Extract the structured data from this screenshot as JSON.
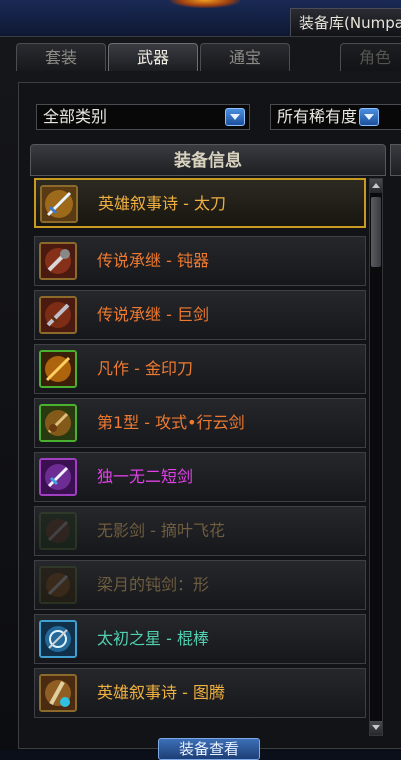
{
  "window": {
    "title": "装备库(Numpa"
  },
  "tabs": [
    {
      "label": "套装",
      "state": "normal"
    },
    {
      "label": "武器",
      "state": "active"
    },
    {
      "label": "通宝",
      "state": "normal"
    },
    {
      "label": "角色",
      "state": "disabled"
    }
  ],
  "filters": {
    "category": {
      "value": "全部类别",
      "icon": "chevron-down-icon"
    },
    "rarity": {
      "value": "所有稀有度",
      "icon": "chevron-down-icon"
    }
  },
  "list": {
    "header": "装备信息",
    "items": [
      {
        "name": "英雄叙事诗 - 太刀",
        "color": "#f0b040",
        "selected": true,
        "icon": "katana-icon"
      },
      {
        "name": "传说承继 - 钝器",
        "color": "#f07a30",
        "selected": false,
        "icon": "mace-icon"
      },
      {
        "name": "传说承继 - 巨剑",
        "color": "#f07a30",
        "selected": false,
        "icon": "greatsword-icon"
      },
      {
        "name": "凡作 - 金印刀",
        "color": "#f07a30",
        "selected": false,
        "icon": "blade-icon"
      },
      {
        "name": "第1型 - 攻式•行云剑",
        "color": "#f07a30",
        "selected": false,
        "icon": "sword-icon"
      },
      {
        "name": "独一无二短剑",
        "color": "#e040e8",
        "selected": false,
        "icon": "dagger-icon"
      },
      {
        "name": "无影剑 - 摘叶飞花",
        "color": "#6f5d3f",
        "selected": false,
        "icon": "shadow-sword-icon"
      },
      {
        "name": "梁月的钝剑：形",
        "color": "#6f5d3f",
        "selected": false,
        "icon": "blunt-sword-icon"
      },
      {
        "name": "太初之星 - 棍棒",
        "color": "#50d0b0",
        "selected": false,
        "icon": "staff-icon"
      },
      {
        "name": "英雄叙事诗 - 图腾",
        "color": "#f0b040",
        "selected": false,
        "icon": "totem-icon"
      }
    ]
  },
  "bottom_button": {
    "label": "装备查看"
  }
}
